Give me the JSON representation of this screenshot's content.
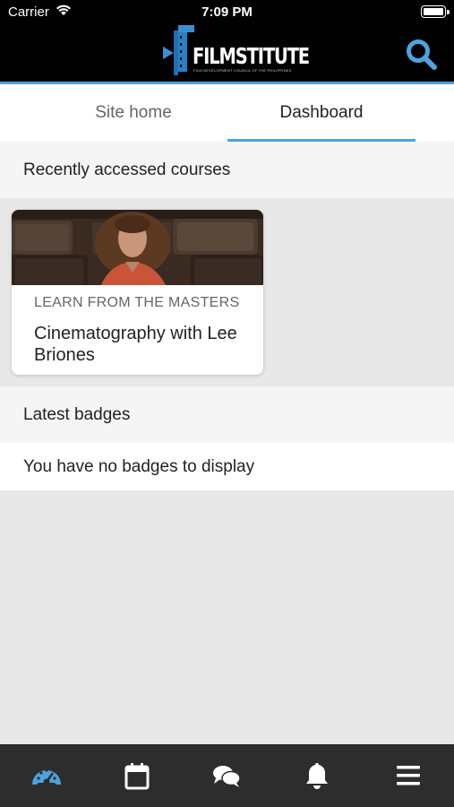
{
  "status_bar": {
    "carrier": "Carrier",
    "time": "7:09 PM"
  },
  "header": {
    "logo_text": "FILMSTITUTE",
    "logo_subtitle": "FILM DEVELOPMENT COUNCIL OF THE PHILIPPINES",
    "search_icon": "search-icon",
    "accent_color": "#4fa2dc"
  },
  "tabs": [
    {
      "label": "Site home",
      "active": false
    },
    {
      "label": "Dashboard",
      "active": true
    }
  ],
  "recent_courses": {
    "header": "Recently accessed courses",
    "courses": [
      {
        "category": "LEARN FROM THE MASTERS",
        "name": "Cinematography with Lee Briones"
      }
    ]
  },
  "badges": {
    "header": "Latest badges",
    "empty_message": "You have no badges to display"
  },
  "bottom_nav": {
    "items": [
      {
        "icon": "dashboard-icon",
        "active": true
      },
      {
        "icon": "calendar-icon",
        "active": false
      },
      {
        "icon": "messages-icon",
        "active": false
      },
      {
        "icon": "notifications-icon",
        "active": false
      },
      {
        "icon": "menu-icon",
        "active": false
      }
    ]
  }
}
